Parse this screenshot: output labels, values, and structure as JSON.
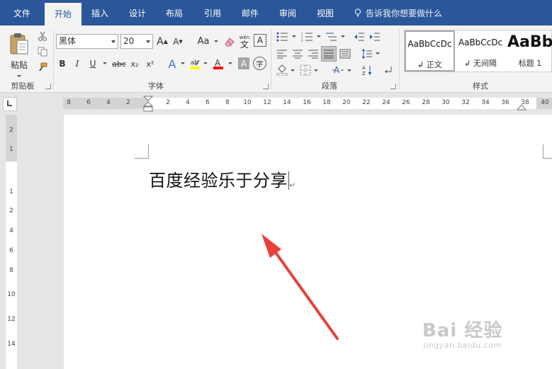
{
  "tabs": [
    {
      "label": "文件",
      "active": false
    },
    {
      "label": "开始",
      "active": true
    },
    {
      "label": "插入",
      "active": false
    },
    {
      "label": "设计",
      "active": false
    },
    {
      "label": "布局",
      "active": false
    },
    {
      "label": "引用",
      "active": false
    },
    {
      "label": "邮件",
      "active": false
    },
    {
      "label": "审阅",
      "active": false
    },
    {
      "label": "视图",
      "active": false
    }
  ],
  "tell_me": "告诉我你想要做什么",
  "clipboard": {
    "paste_label": "粘贴",
    "group_label": "剪贴板"
  },
  "font": {
    "name": "黑体",
    "size": "20",
    "case_label": "Aa",
    "group_label": "字体",
    "bold": "B",
    "italic": "I",
    "underline": "U",
    "strike": "abc",
    "subscript": "x₂",
    "superscript": "x²",
    "grow": "A",
    "shrink": "A",
    "phonetic": "wén",
    "phonetic_char": "文",
    "border_char": "A",
    "shade_char": "A",
    "enclose_char": "字"
  },
  "paragraph": {
    "group_label": "段落"
  },
  "styles": {
    "group_label": "样式",
    "items": [
      {
        "sample": "AaBbCcDc",
        "name": "正文"
      },
      {
        "sample": "AaBbCcDc",
        "name": "无间隔"
      },
      {
        "sample": "AaBb",
        "name": "标题 1"
      }
    ]
  },
  "ruler": {
    "h_labels": [
      "8",
      "6",
      "4",
      "2",
      "2",
      "4",
      "6",
      "8",
      "10",
      "12",
      "14",
      "16",
      "18",
      "20",
      "22",
      "24",
      "26",
      "28",
      "30",
      "32",
      "34",
      "36",
      "38",
      "40"
    ],
    "v_labels": [
      "2",
      "1",
      "1",
      "2",
      "4",
      "6",
      "8",
      "10",
      "12",
      "14"
    ]
  },
  "document": {
    "text": "百度经验乐于分享",
    "para_mark": "↵"
  },
  "watermark": {
    "main": "Bai 经验",
    "sub": "jingyan.baidu.com"
  },
  "colors": {
    "ribbon_blue": "#2b579a",
    "arrow_red": "#e8413a",
    "highlight_yellow": "#ffff00",
    "font_red": "#ff0000"
  }
}
